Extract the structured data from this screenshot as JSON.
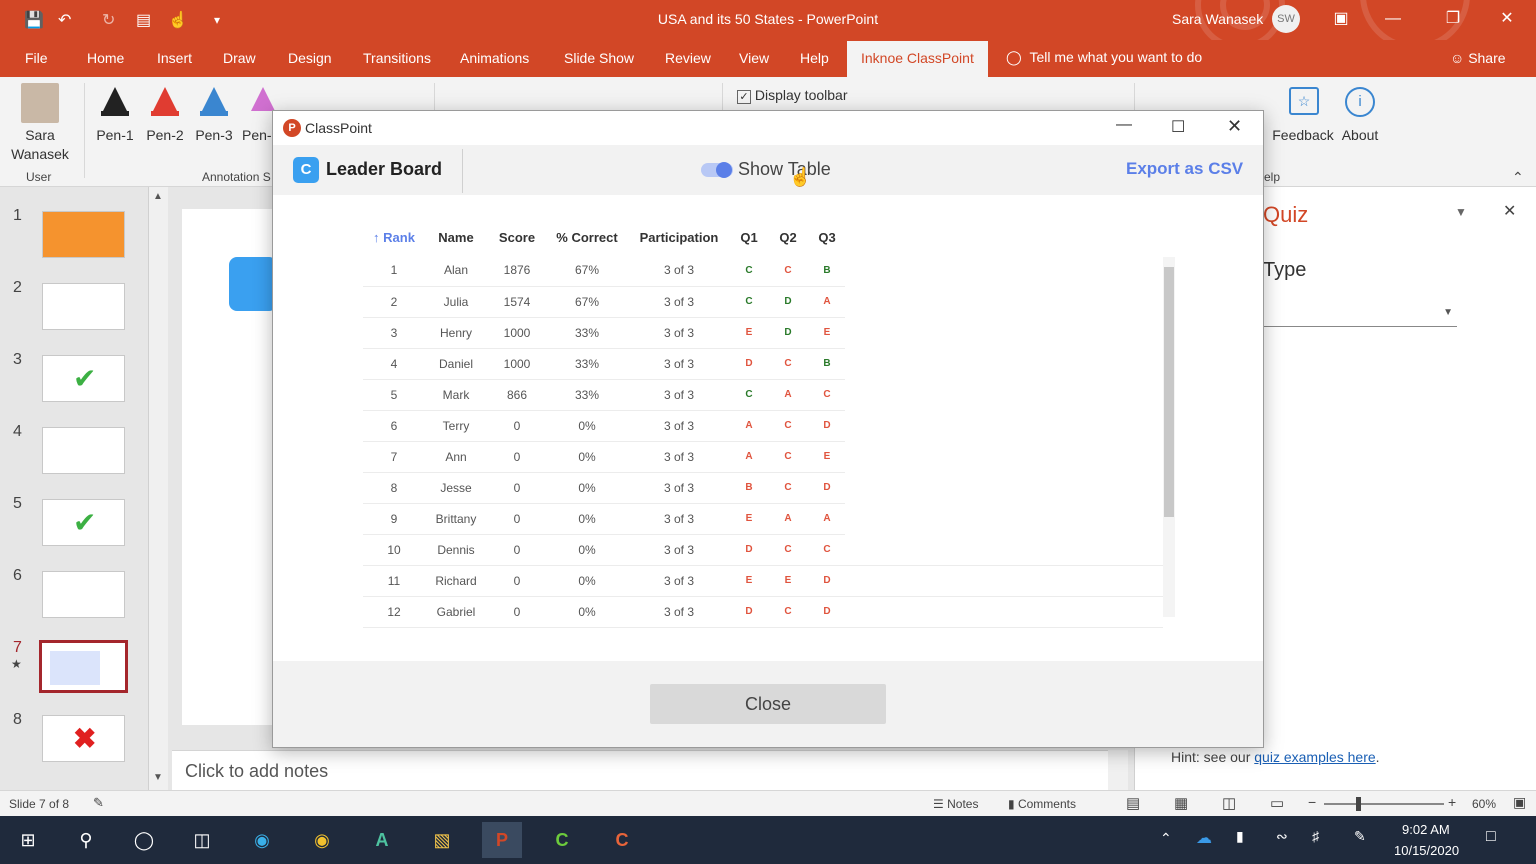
{
  "window": {
    "title": "USA and its 50 States - PowerPoint",
    "user": "Sara Wanasek",
    "user_initials": "SW"
  },
  "tabs": [
    "File",
    "Home",
    "Insert",
    "Draw",
    "Design",
    "Transitions",
    "Animations",
    "Slide Show",
    "Review",
    "View",
    "Help",
    "Inknoe ClassPoint"
  ],
  "active_tab": "Inknoe ClassPoint",
  "tell_me": "Tell me what you want to do",
  "share": "Share",
  "ribbon": {
    "user_first": "Sara",
    "user_last": "Wanasek",
    "group_user": "User",
    "pens": [
      "Pen-1",
      "Pen-2",
      "Pen-3",
      "Pen-"
    ],
    "group_annotation": "Annotation S",
    "display_toolbar": "Display toolbar",
    "feedback": "Feedback",
    "about": "About",
    "group_help_partial": "elp",
    "colors": {
      "pen1": "#222222",
      "pen2": "#e03c31",
      "pen3": "#3a86d0",
      "pen4": "#d070d0",
      "pen5": "#f2a020"
    }
  },
  "thumbnails": [
    "1",
    "2",
    "3",
    "4",
    "5",
    "6",
    "7",
    "8"
  ],
  "selected_slide": "7",
  "notes_placeholder": "Click to add notes",
  "taskpane": {
    "title_partial": "Quiz",
    "type_label": "Type",
    "hint_prefix": "Hint: see our ",
    "hint_link": "quiz examples here",
    "hint_suffix": "."
  },
  "status": {
    "slide": "Slide 7 of 8",
    "notes": "Notes",
    "comments": "Comments",
    "zoom": "60%"
  },
  "taskbar": {
    "time": "9:02 AM",
    "date": "10/15/2020"
  },
  "dialog": {
    "title": "ClassPoint",
    "header_title": "Leader Board",
    "show_table": "Show Table",
    "export": "Export as CSV",
    "close": "Close",
    "columns": [
      "Rank",
      "Name",
      "Score",
      "% Correct",
      "Participation",
      "Q1",
      "Q2",
      "Q3"
    ],
    "rows": [
      {
        "rank": "1",
        "name": "Alan",
        "score": "1876",
        "pct": "67%",
        "part": "3 of 3",
        "q1": "C",
        "q2": "C",
        "q3": "B",
        "c1": true,
        "c2": false,
        "c3": true
      },
      {
        "rank": "2",
        "name": "Julia",
        "score": "1574",
        "pct": "67%",
        "part": "3 of 3",
        "q1": "C",
        "q2": "D",
        "q3": "A",
        "c1": true,
        "c2": true,
        "c3": false
      },
      {
        "rank": "3",
        "name": "Henry",
        "score": "1000",
        "pct": "33%",
        "part": "3 of 3",
        "q1": "E",
        "q2": "D",
        "q3": "E",
        "c1": false,
        "c2": true,
        "c3": false
      },
      {
        "rank": "4",
        "name": "Daniel",
        "score": "1000",
        "pct": "33%",
        "part": "3 of 3",
        "q1": "D",
        "q2": "C",
        "q3": "B",
        "c1": false,
        "c2": false,
        "c3": true
      },
      {
        "rank": "5",
        "name": "Mark",
        "score": "866",
        "pct": "33%",
        "part": "3 of 3",
        "q1": "C",
        "q2": "A",
        "q3": "C",
        "c1": true,
        "c2": false,
        "c3": false
      },
      {
        "rank": "6",
        "name": "Terry",
        "score": "0",
        "pct": "0%",
        "part": "3 of 3",
        "q1": "A",
        "q2": "C",
        "q3": "D",
        "c1": false,
        "c2": false,
        "c3": false
      },
      {
        "rank": "7",
        "name": "Ann",
        "score": "0",
        "pct": "0%",
        "part": "3 of 3",
        "q1": "A",
        "q2": "C",
        "q3": "E",
        "c1": false,
        "c2": false,
        "c3": false
      },
      {
        "rank": "8",
        "name": "Jesse",
        "score": "0",
        "pct": "0%",
        "part": "3 of 3",
        "q1": "B",
        "q2": "C",
        "q3": "D",
        "c1": false,
        "c2": false,
        "c3": false
      },
      {
        "rank": "9",
        "name": "Brittany",
        "score": "0",
        "pct": "0%",
        "part": "3 of 3",
        "q1": "E",
        "q2": "A",
        "q3": "A",
        "c1": false,
        "c2": false,
        "c3": false
      },
      {
        "rank": "10",
        "name": "Dennis",
        "score": "0",
        "pct": "0%",
        "part": "3 of 3",
        "q1": "D",
        "q2": "C",
        "q3": "C",
        "c1": false,
        "c2": false,
        "c3": false
      },
      {
        "rank": "11",
        "name": "Richard",
        "score": "0",
        "pct": "0%",
        "part": "3 of 3",
        "q1": "E",
        "q2": "E",
        "q3": "D",
        "c1": false,
        "c2": false,
        "c3": false
      },
      {
        "rank": "12",
        "name": "Gabriel",
        "score": "0",
        "pct": "0%",
        "part": "3 of 3",
        "q1": "D",
        "q2": "C",
        "q3": "D",
        "c1": false,
        "c2": false,
        "c3": false
      }
    ]
  }
}
